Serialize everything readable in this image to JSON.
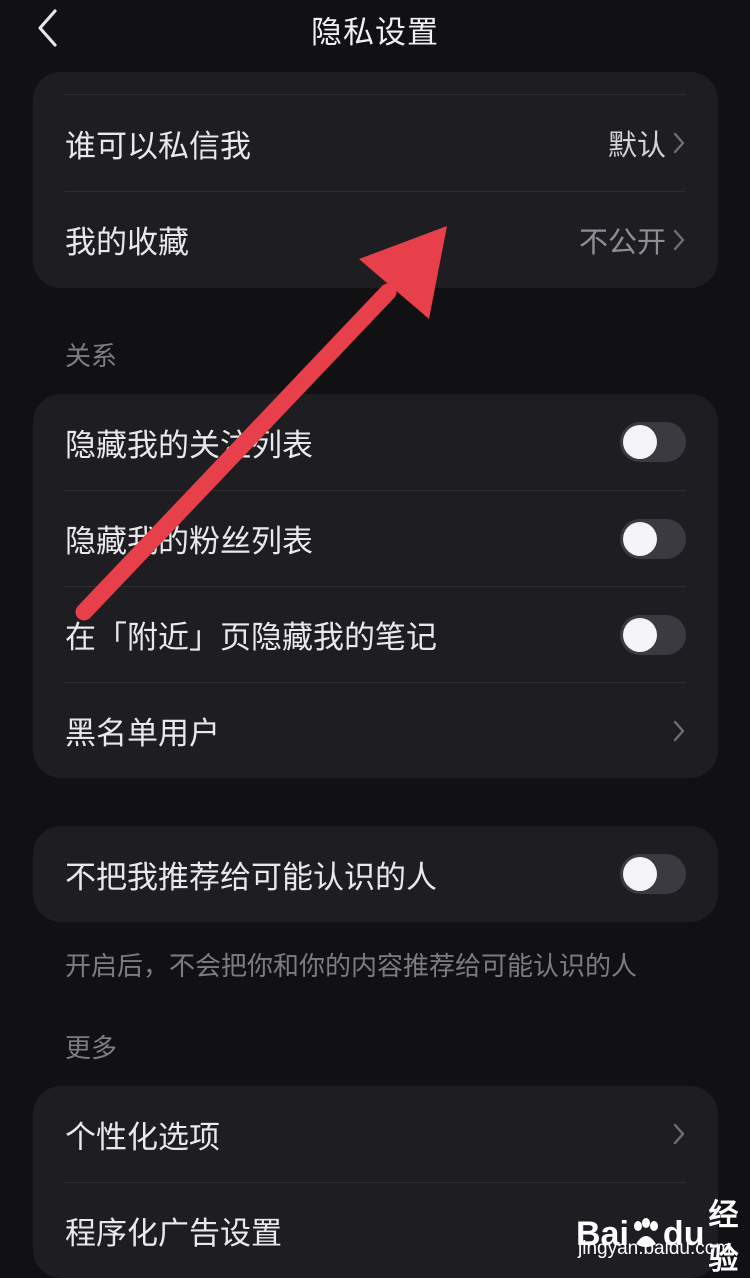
{
  "header": {
    "title": "隐私设置",
    "back_icon": "chevron-left-icon"
  },
  "card_top": {
    "items": [
      {
        "label": "谁可以私信我",
        "value": "默认"
      },
      {
        "label": "我的收藏",
        "value": "不公开"
      }
    ]
  },
  "section_relations": {
    "title": "关系",
    "items": [
      {
        "label": "隐藏我的关注列表",
        "toggle": false
      },
      {
        "label": "隐藏我的粉丝列表",
        "toggle": false
      },
      {
        "label": "在「附近」页隐藏我的笔记",
        "toggle": false
      },
      {
        "label": "黑名单用户"
      }
    ]
  },
  "recommend": {
    "label": "不把我推荐给可能认识的人",
    "toggle": false,
    "hint": "开启后，不会把你和你的内容推荐给可能认识的人"
  },
  "section_more": {
    "title": "更多",
    "items": [
      {
        "label": "个性化选项"
      },
      {
        "label": "程序化广告设置"
      }
    ]
  },
  "watermark": {
    "brand_left": "Bai",
    "brand_right": "du",
    "suffix": "经验",
    "url": "jingyan.baidu.com"
  },
  "colors": {
    "background": "#111114",
    "card": "#1e1e22",
    "arrow": "#e8404a",
    "toggle_off": "#3a3a40"
  }
}
